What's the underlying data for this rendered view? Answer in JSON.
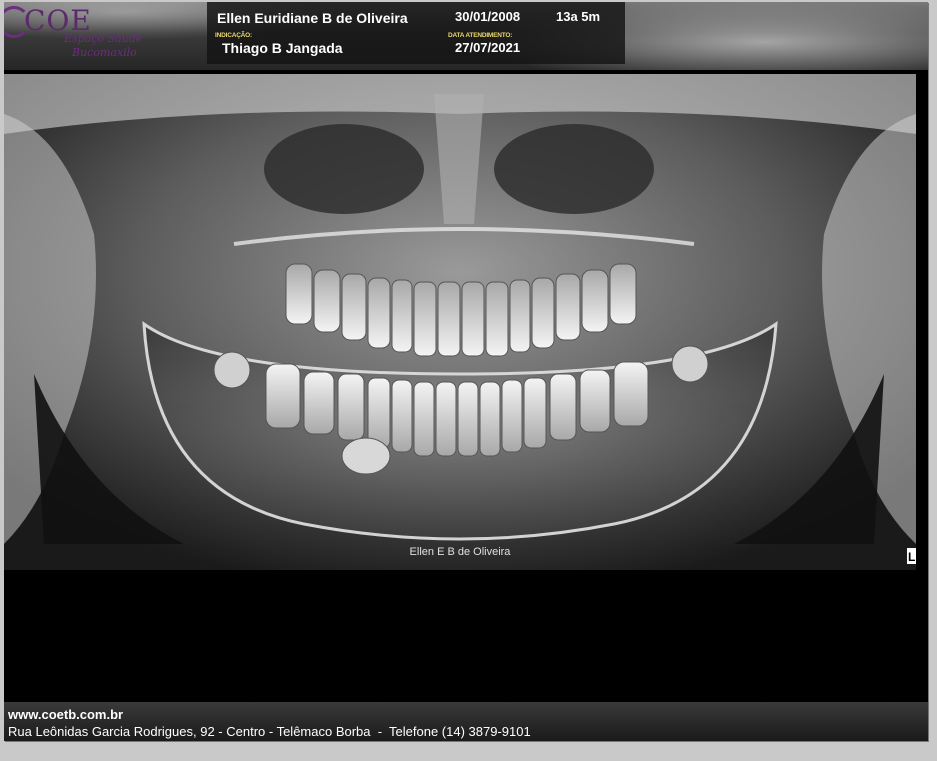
{
  "logo": {
    "name": "COE",
    "tagline_1": "Espaço Saude",
    "tagline_2": "Bucomaxilo"
  },
  "patient": {
    "name": "Ellen Euridiane B de Oliveira",
    "birth_date": "30/01/2008",
    "age": "13a 5m"
  },
  "referral": {
    "label": "INDICAÇÃO:",
    "doctor": "Thiago B Jangada"
  },
  "visit": {
    "label": "DATA ATENDIMENTO:",
    "date": "27/07/2021"
  },
  "xray": {
    "caption": "Ellen E B de Oliveira",
    "side_marker": "L"
  },
  "footer": {
    "website": "www.coetb.com.br",
    "address": "Rua Leônidas Garcia Rodrigues, 92 - Centro - Telêmaco Borba  -  Telefone (14) 3879-9101"
  }
}
